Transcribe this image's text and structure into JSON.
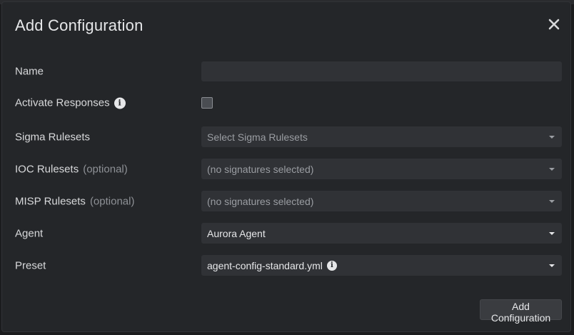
{
  "dialog": {
    "title": "Add Configuration",
    "close_icon": "close-icon"
  },
  "fields": {
    "name": {
      "label": "Name",
      "value": "",
      "placeholder": ""
    },
    "activate_responses": {
      "label": "Activate Responses",
      "checked": false,
      "icon": "info-icon"
    },
    "sigma_rulesets": {
      "label": "Sigma Rulesets",
      "value": "Select Sigma Rulesets"
    },
    "ioc_rulesets": {
      "label": "IOC Rulesets",
      "optional": "(optional)",
      "value": "(no signatures selected)"
    },
    "misp_rulesets": {
      "label": "MISP Rulesets",
      "optional": "(optional)",
      "value": "(no signatures selected)"
    },
    "agent": {
      "label": "Agent",
      "value": "Aurora Agent"
    },
    "preset": {
      "label": "Preset",
      "value": "agent-config-standard.yml",
      "icon": "info-icon"
    }
  },
  "actions": {
    "submit_label": "Add Configuration"
  },
  "colors": {
    "background": "#242629",
    "input": "#303236",
    "text": "#d8d9db",
    "muted": "#8e9196"
  }
}
